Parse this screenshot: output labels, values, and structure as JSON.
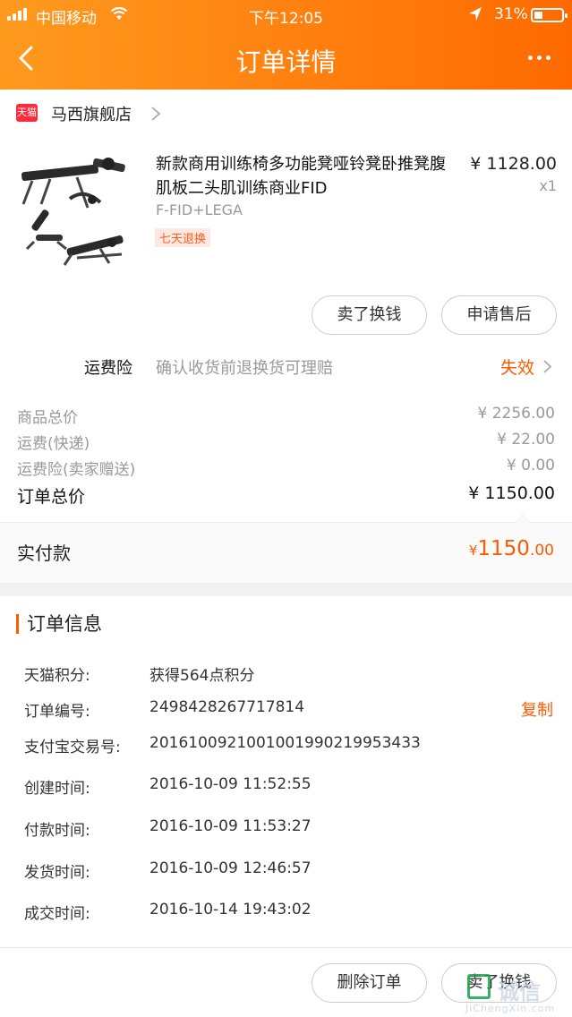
{
  "status_bar": {
    "carrier": "中国移动",
    "time": "下午12:05",
    "battery": "31%"
  },
  "nav": {
    "title": "订单详情"
  },
  "shop": {
    "badge": "天猫",
    "name": "马西旗舰店"
  },
  "product": {
    "title": "新款商用训练椅多功能凳哑铃凳卧推凳腹肌板二头肌训练商业FID",
    "sku": "F-FID+LEGA",
    "badge": "七天退换",
    "price": "¥ 1128.00",
    "qty": "x1"
  },
  "item_actions": {
    "sell": "卖了换钱",
    "after_sale": "申请售后"
  },
  "insurance": {
    "label": "运费险",
    "desc": "确认收货前退换货可理赔",
    "status": "失效"
  },
  "summary": {
    "goods_label": "商品总价",
    "goods_value": "¥ 2256.00",
    "shipping_label": "运费(快递)",
    "shipping_value": "¥ 22.00",
    "ins_label": "运费险(卖家赠送)",
    "ins_value": "¥ 0.00",
    "total_label": "订单总价",
    "total_value": "¥ 1150.00"
  },
  "paid": {
    "label": "实付款",
    "currency": "¥",
    "integer": "1150",
    "decimal": ".00"
  },
  "order_info": {
    "heading": "订单信息",
    "copy": "复制",
    "rows": [
      {
        "label": "天猫积分:",
        "value": "获得564点积分"
      },
      {
        "label": "订单编号:",
        "value": "2498428267717814"
      },
      {
        "label": "支付宝交易号:",
        "value": "2016100921001001990219953433"
      },
      {
        "label": "创建时间:",
        "value": "2016-10-09 11:52:55"
      },
      {
        "label": "付款时间:",
        "value": "2016-10-09 11:53:27"
      },
      {
        "label": "发货时间:",
        "value": "2016-10-09 12:46:57"
      },
      {
        "label": "成交时间:",
        "value": "2016-10-14 19:43:02"
      }
    ]
  },
  "bottom_actions": {
    "delete": "删除订单",
    "sell": "卖了换钱"
  },
  "watermark": {
    "text": "诚信",
    "url": "JiChengXin.com"
  },
  "colors": {
    "accent": "#ff5a00",
    "header_start": "#ff9a1f",
    "header_end": "#ff6a00"
  }
}
